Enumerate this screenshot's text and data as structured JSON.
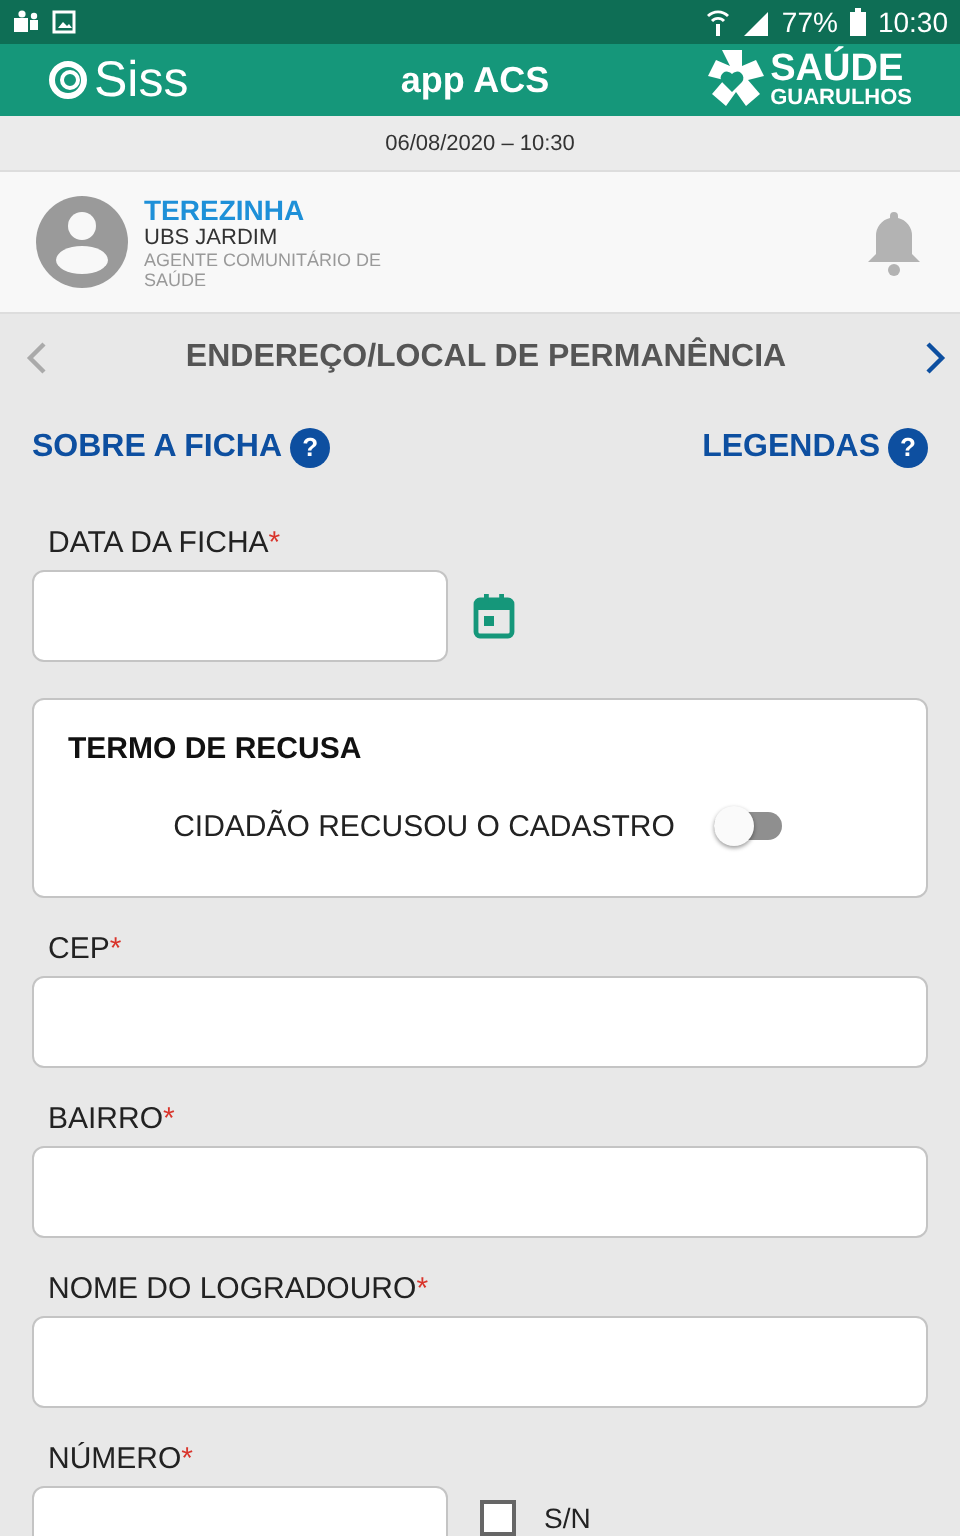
{
  "status_bar": {
    "battery": "77%",
    "time": "10:30"
  },
  "header": {
    "logo_left": "Siss",
    "title": "app ACS",
    "logo_right_top": "SAÚDE",
    "logo_right_bottom": "GUARULHOS"
  },
  "date_bar": "06/08/2020 – 10:30",
  "profile": {
    "name": "TEREZINHA",
    "unit": "UBS JARDIM",
    "role": "AGENTE COMUNITÁRIO DE SAÚDE"
  },
  "section_nav": {
    "title": "ENDEREÇO/LOCAL DE PERMANÊNCIA",
    "prev_disabled": true,
    "next_disabled": false
  },
  "links": [
    {
      "label": "SOBRE A FICHA",
      "help": "?"
    },
    {
      "label": "LEGENDAS",
      "help": "?"
    }
  ],
  "form": [
    {
      "kind": "date",
      "label": "DATA DA FICHA",
      "required_mark": "*"
    },
    {
      "kind": "refusal",
      "title": "TERMO DE RECUSA",
      "toggle_label": "CIDADÃO RECUSOU O CADASTRO",
      "on": false
    },
    {
      "kind": "text",
      "label": "CEP",
      "required_mark": "*"
    },
    {
      "kind": "text",
      "label": "BAIRRO",
      "required_mark": "*"
    },
    {
      "kind": "text",
      "label": "NOME DO LOGRADOURO",
      "required_mark": "*"
    },
    {
      "kind": "number",
      "label": "NÚMERO",
      "required_mark": "*",
      "checkbox_label": "S/N",
      "checked": false
    }
  ]
}
